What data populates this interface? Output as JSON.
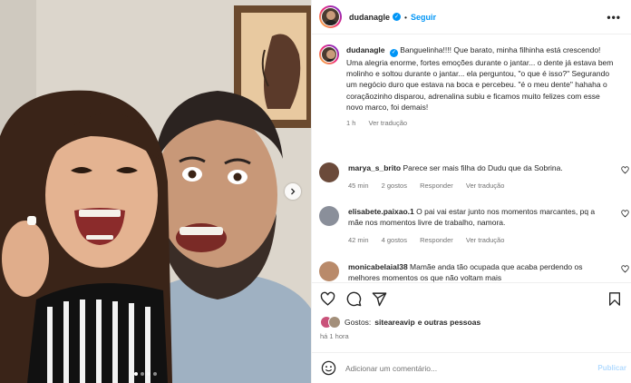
{
  "post": {
    "username": "dudanagle",
    "follow_label": "Seguir",
    "separator": "•",
    "more_label": "•••",
    "caption_text": "Banguelinha!!!! Que barato, minha filhinha está crescendo! Uma alegria enorme, fortes emoções durante o jantar... o dente já estava bem molinho e soltou durante o jantar... ela perguntou, \"o que é isso?\" Segurando um negócio duro que estava na boca e percebeu. \"é o meu dente\" hahaha o coraçãozinho disparou, adrenalina subiu e ficamos muito felizes com esse novo marco, foi demais!",
    "caption_time": "1 h",
    "caption_translate": "Ver tradução"
  },
  "comments": [
    {
      "username": "marya_s_brito",
      "text": "Parece ser mais filha do Dudu que da Sobrina.",
      "time": "45 min",
      "likes": "2 gostos",
      "reply": "Responder",
      "translate": "Ver tradução",
      "avatar_color": "#6b4a3a"
    },
    {
      "username": "elisabete.paixao.1",
      "text": "O pai vai estar junto nos momentos marcantes, pq a mãe nos momentos livre de trabalho, namora.",
      "time": "42 min",
      "likes": "4 gostos",
      "reply": "Responder",
      "translate": "Ver tradução",
      "avatar_color": "#8a8f9a"
    },
    {
      "username": "monicabelaial38",
      "text": "Mamãe anda tão ocupada que acaba perdendo os melhores momentos os que não voltam mais",
      "avatar_color": "#b98a6a"
    }
  ],
  "likes_line": {
    "prefix": "Gostos:",
    "user": "siteareavip",
    "suffix": "e outras pessoas"
  },
  "post_time": "há 1 hora",
  "add_comment": {
    "placeholder": "Adicionar um comentário...",
    "publish_label": "Publicar"
  },
  "icons": [
    "emoji-icon",
    "heart-icon",
    "comment-icon",
    "share-icon",
    "bookmark-icon",
    "chevron-right-icon",
    "verified-icon"
  ],
  "colors": {
    "accent": "#0095f6",
    "muted": "#737373",
    "publish_disabled": "#b3dbff"
  }
}
